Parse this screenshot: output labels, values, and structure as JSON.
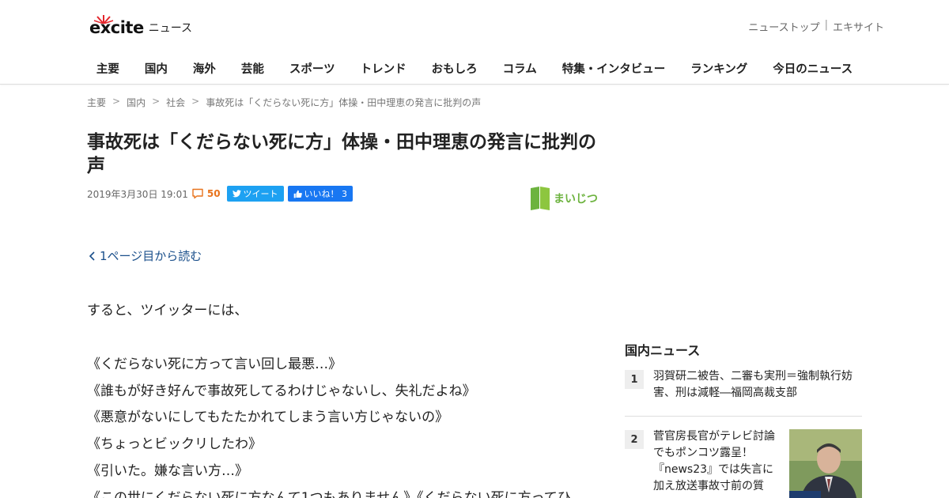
{
  "header": {
    "logo_word": "excite",
    "logo_suffix": "ニュース",
    "toplinks": [
      "ニューストップ",
      "エキサイト"
    ],
    "toplink_separator": "|",
    "nav": [
      "主要",
      "国内",
      "海外",
      "芸能",
      "スポーツ",
      "トレンド",
      "おもしろ",
      "コラム",
      "特集・インタビュー",
      "ランキング",
      "今日のニュース"
    ]
  },
  "breadcrumb": {
    "items": [
      "主要",
      "国内",
      "社会",
      "事故死は「くだらない死に方」体操・田中理恵の発言に批判の声"
    ],
    "separator": ">"
  },
  "article": {
    "title": "事故死は「くだらない死に方」体操・田中理恵の発言に批判の声",
    "date": "2019年3月30日 19:01",
    "comment_count": "50",
    "tweet_label": "ツイート",
    "like_label": "いいね！ 3",
    "source_name": "まいじつ",
    "prev_page_link": "1ページ目から読む",
    "body": [
      "すると、ツイッターには、",
      "《くだらない死に方って言い回し最悪…》",
      "《誰もが好き好んで事故死してるわけじゃないし、失礼だよね》",
      "《悪意がないにしてもたたかれてしまう言い方じゃないの》",
      "《ちょっとビックリしたわ》",
      "《引いた。嫌な言い方…》",
      "《この世にくだらない死に方なんて1つもありません》《くだらない死に方ってひ"
    ]
  },
  "sidebar": {
    "title": "国内ニュース",
    "items": [
      {
        "rank": "1",
        "text": "羽賀研二被告、二審も実刑＝強制執行妨害、刑は減軽―福岡高裁支部"
      },
      {
        "rank": "2",
        "text": "菅官房長官がテレビ討論でもポンコツ露呈！『news23』では失言に加え放送事故寸前の質"
      }
    ]
  },
  "colors": {
    "brand_red": "#e4262c",
    "twitter": "#1da1f2",
    "facebook": "#1877f2",
    "comment_orange": "#e8731c",
    "link_blue": "#1a4f8b",
    "source_green": "#6db33f"
  }
}
